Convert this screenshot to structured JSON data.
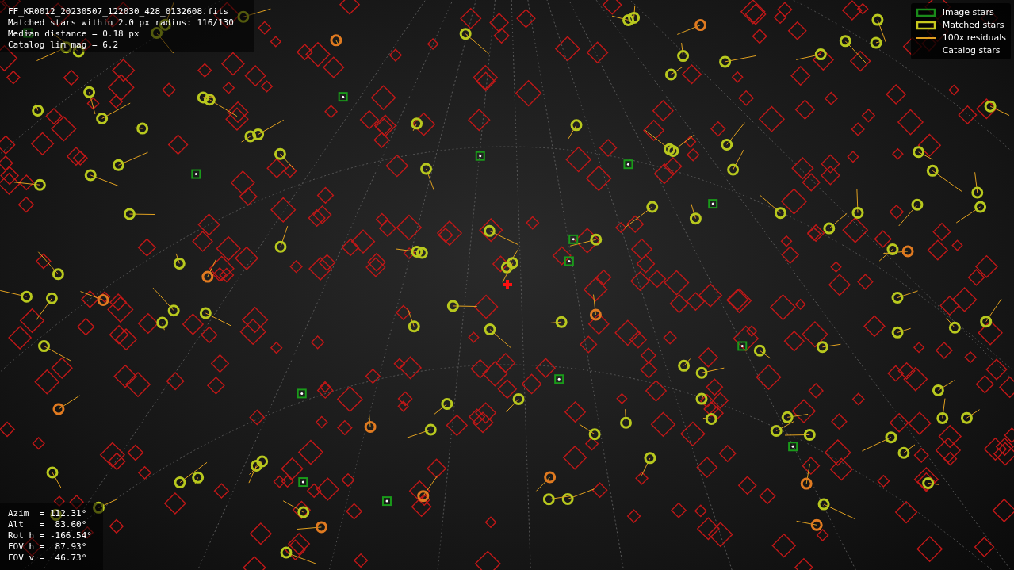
{
  "header_lines": [
    "FF_KR0012_20230507_122030_428_0132608.fits",
    "Matched stars within 2.0 px radius: 116/130",
    "Median distance = 0.18 px",
    "Catalog lim mag = 6.2"
  ],
  "legend": [
    {
      "kind": "box",
      "color": "#1a8a1a",
      "label": "Image stars"
    },
    {
      "kind": "box",
      "color": "#c8c81e",
      "label": "Matched stars"
    },
    {
      "kind": "line",
      "color": "#e0a020",
      "label": "100x residuals"
    },
    {
      "kind": "blank",
      "label": "Catalog stars"
    }
  ],
  "pointing_lines": [
    "Azim  = 112.31°",
    "Alt   =  83.60°",
    "Rot h = -166.54°",
    "FOV h =  87.93°",
    "FOV v =  46.73°"
  ]
}
